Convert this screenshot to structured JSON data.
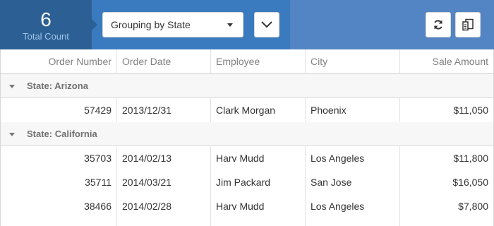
{
  "summary": {
    "count": "6",
    "count_label": "Total Count"
  },
  "toolbar": {
    "grouping_value": "Grouping by State",
    "expand_icon": "chevron-down-icon",
    "refresh_icon": "refresh-icon",
    "export_icon": "export-icon"
  },
  "columns": [
    "Order Number",
    "Order Date",
    "Employee",
    "City",
    "Sale Amount"
  ],
  "groups": [
    {
      "label": "State: Arizona",
      "rows": [
        {
          "order": "57429",
          "date": "2013/12/31",
          "employee": "Clark Morgan",
          "city": "Phoenix",
          "amount": "$11,050"
        }
      ]
    },
    {
      "label": "State: California",
      "rows": [
        {
          "order": "35703",
          "date": "2014/02/13",
          "employee": "Harv Mudd",
          "city": "Los Angeles",
          "amount": "$11,800"
        },
        {
          "order": "35711",
          "date": "2014/03/21",
          "employee": "Jim Packard",
          "city": "San Jose",
          "amount": "$16,050"
        },
        {
          "order": "38466",
          "date": "2014/02/28",
          "employee": "Harv Mudd",
          "city": "Los Angeles",
          "amount": "$7,800"
        }
      ]
    }
  ],
  "colors": {
    "count_bg": "#2c5f93",
    "toolbar_bg": "#3a7abf",
    "toolbar_right_bg": "#5384c3",
    "group_bg": "#f7f7f7"
  }
}
